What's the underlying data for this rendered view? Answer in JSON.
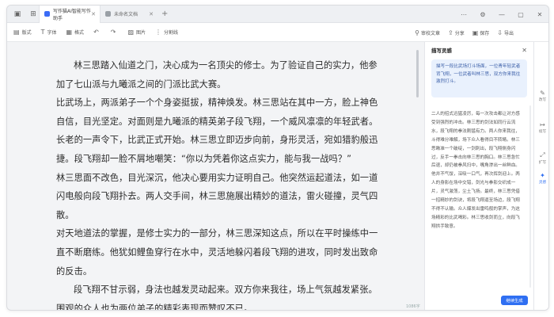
{
  "tabs": [
    {
      "label": "写作猫AI智能写作助手"
    },
    {
      "label": "未命名文档"
    }
  ],
  "toolbar": {
    "items": [
      {
        "icon": "layout-icon",
        "label": "版式"
      },
      {
        "icon": "font-icon",
        "label": "字体"
      },
      {
        "icon": "format-icon",
        "label": "格式"
      },
      {
        "icon": "undo-icon",
        "label": ""
      },
      {
        "icon": "redo-icon",
        "label": ""
      },
      {
        "icon": "image-icon",
        "label": "图片"
      },
      {
        "icon": "split-icon",
        "label": "分割线"
      }
    ],
    "right": [
      {
        "icon": "review-icon",
        "label": "审校文章"
      },
      {
        "icon": "share-icon",
        "label": "分享"
      },
      {
        "icon": "save-icon",
        "label": "保存"
      },
      {
        "icon": "export-icon",
        "label": "导出"
      }
    ]
  },
  "document": {
    "paragraphs": [
      {
        "text": "林三思踏入仙道之门，决心成为一名顶尖的修士。为了验证自己的实力，他参加了七山派与九曦派之间的门派比武大赛。",
        "indent": true
      },
      {
        "text": "比武场上，两派弟子一个个身姿挺拔，精神焕发。林三思站在其中一方，脸上神色自信，目光坚定。对面则是九曦派的精英弟子段飞翔，一个威风凛凛的年轻武者。长老的一声令下，比武正式开始。林三思立即迈步向前，身形灵活，宛如猎豹般迅捷。段飞翔却一脸不屑地嘲笑：“你以为凭着你这点实力，能与我一战吗？”",
        "indent": false
      },
      {
        "text": "林三思面不改色，目光深沉，他决心要用实力证明自己。他突然运起道法，如一道闪电般向段飞翔扑去。两人交手间，林三思施展出精妙的道法，雷火碰撞，灵气四散。",
        "indent": false
      },
      {
        "text": "对天地道法的掌握，是修士实力的一部分，林三思深知这点，所以在平时操练中一直不断磨练。他犹如鲤鱼穿行在水中，灵活地躲闪着段飞翔的进攻，同时发出致命的反击。",
        "indent": false
      },
      {
        "text": "段飞翔不甘示弱，身法也越发灵动起来。双方你来我往，场上气氛越发紧张。围观的众人也为两位弟子的精彩表现而赞叹不已。",
        "indent": true
      }
    ],
    "word_count": "1086字"
  },
  "panel": {
    "title": "描写灵感",
    "prompt": "描写一段比武场打斗场面，一位青年轻武者背飞翔，一位武者叫林三思，双方你来我往激烈打斗。",
    "result": "二人的招式迅猛凌厉，每一次攻击都让对方感受到强烈的冲击。林三思的剑法如同行云流水，段飞翔的拳法刚猛有力。两人你来我往，斗得难分难解，场下众人看得目不转睛。林三思瞅准一个破绽，一剑刺出，段飞翔侧身闪过，反手一拳击向林三思的胸口。林三思急忙后退，却仍被拳风扫中，嘴角渗出一丝鲜血。他并不气馁，深吸一口气，再次挥剑迎上。两人的身影在场中交错，剑光与拳影交织成一片，灵气激荡，尘土飞扬。最终，林三思凭借一招精妙的剑诀，将段飞翔逼至场边，段飞翔不得不认输。众人爆发出雷鸣般的掌声，为这场精彩的比武喝彩。林三思收剑而立，向段飞翔拱手致意。",
    "generate_label": "继续生成"
  },
  "rail": [
    {
      "icon": "edit-icon",
      "label": "改写"
    },
    {
      "icon": "continue-icon",
      "label": "续写"
    },
    {
      "icon": "expand-icon",
      "label": "扩写"
    },
    {
      "icon": "inspire-icon",
      "label": "灵感"
    }
  ]
}
